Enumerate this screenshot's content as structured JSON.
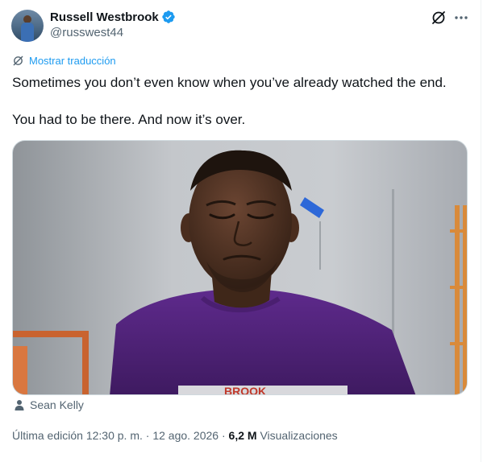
{
  "author": {
    "display_name": "Russell Westbrook",
    "handle": "@russwest44"
  },
  "translate": {
    "label": "Mostrar traducción"
  },
  "tweet": {
    "line1": "Sometimes you don’t even know when you’ve already watched the end.",
    "line2": "You had to be there. And now it’s over."
  },
  "media": {
    "shirt_text": "BROOK",
    "tagged_person": "Sean Kelly"
  },
  "meta": {
    "edit_label": "Última edición",
    "time": "12:30 p. m.",
    "sep1": " · ",
    "date": "12 ago. 2026",
    "sep2": " · ",
    "views_count": "6,2 M",
    "views_label": "Visualizaciones"
  },
  "icons": {
    "verified": "verified-badge-icon",
    "grok": "grok-icon",
    "more": "more-dots-icon",
    "translate": "translate-icon",
    "person": "person-icon"
  },
  "colors": {
    "accent": "#1d9bf0",
    "text_primary": "#0f1419",
    "text_secondary": "#536471",
    "shirt": "#5b2a86"
  }
}
